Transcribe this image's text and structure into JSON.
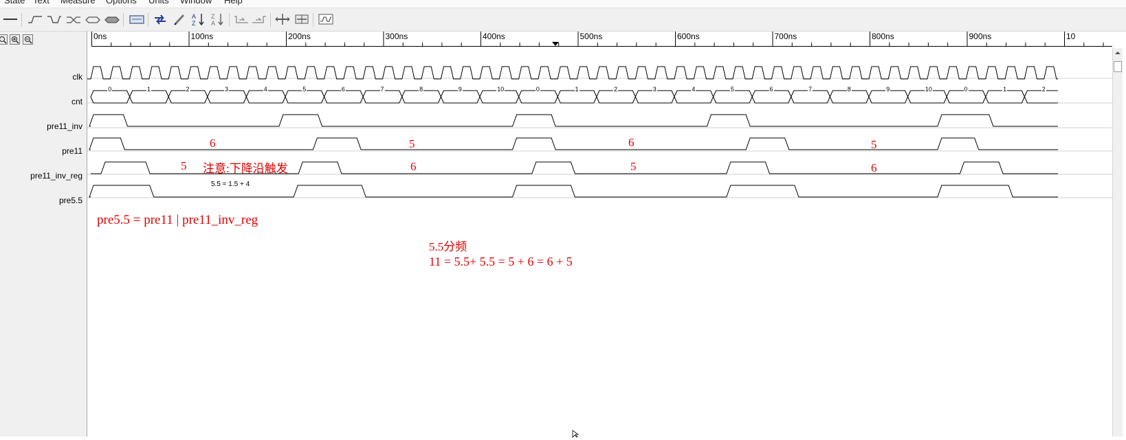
{
  "menu": [
    "State",
    "Text",
    "Measure",
    "Options",
    "Units",
    "Window",
    "Help"
  ],
  "toolbar": {
    "icons": [
      "line-icon",
      "rise-edge-icon",
      "fall-edge-icon",
      "bus-transition-icon",
      "bus-open-icon",
      "bus-filled-icon",
      "waveform-block-icon",
      "redo-arrow-icon",
      "pencil-icon",
      "sort-az-icon",
      "sort-za-icon",
      "shrink-left-icon",
      "expand-right-icon",
      "insert-time-icon",
      "delete-time-icon",
      "waveform-view-icon"
    ]
  },
  "timeline": {
    "labels": [
      "0ns",
      "100ns",
      "200ns",
      "300ns",
      "400ns",
      "500ns",
      "600ns",
      "700ns",
      "800ns",
      "900ns",
      "10"
    ],
    "cursor_ns": 477
  },
  "signals": {
    "names": [
      "clk",
      "cnt",
      "pre11_inv",
      "pre11",
      "pre11_inv_reg",
      "pre5.5"
    ],
    "cnt_values": [
      "0",
      "1",
      "2",
      "3",
      "4",
      "5",
      "6",
      "7",
      "8",
      "9",
      "10",
      "0",
      "1",
      "2",
      "3",
      "4",
      "5",
      "6",
      "7",
      "8",
      "9",
      "10",
      "0",
      "1",
      "2"
    ]
  },
  "annotations": {
    "pre11_counts": [
      "6",
      "5",
      "6",
      "5"
    ],
    "pre11_inv_reg_counts": [
      "5",
      "6",
      "5",
      "6"
    ],
    "note_falling_edge": "注意:下降沿触发",
    "formula_small": "5.5 =  1.5 + 4",
    "formula_or": "pre5.5 = pre11 | pre11_inv_reg",
    "division_title": "5.5分频",
    "division_formula": "11 = 5.5+  5.5 = 5 + 6 = 6 + 5"
  },
  "colors": {
    "annotation": "#e00000",
    "waveform": "#000000"
  }
}
